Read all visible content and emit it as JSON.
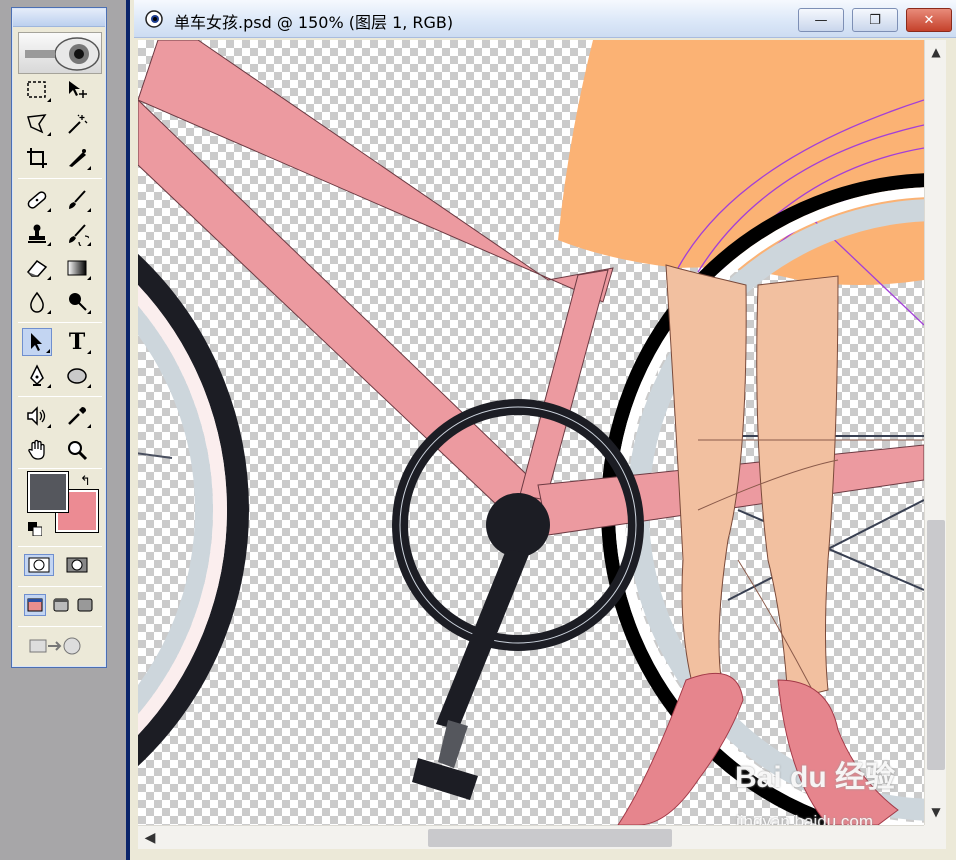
{
  "document": {
    "title": "单车女孩.psd @ 150% (图层 1, RGB)",
    "minimize_label": "—",
    "restore_label": "❐",
    "close_label": "✕"
  },
  "toolbox": {
    "tools": [
      {
        "name": "rectangular-marquee-icon",
        "active": false
      },
      {
        "name": "move-icon",
        "active": false
      },
      {
        "name": "polygonal-lasso-icon",
        "active": false
      },
      {
        "name": "magic-wand-icon",
        "active": false
      },
      {
        "name": "crop-icon",
        "active": false
      },
      {
        "name": "slice-icon",
        "active": false
      },
      {
        "name": "healing-brush-icon",
        "active": false
      },
      {
        "name": "brush-icon",
        "active": false
      },
      {
        "name": "clone-stamp-icon",
        "active": false
      },
      {
        "name": "history-brush-icon",
        "active": false
      },
      {
        "name": "eraser-icon",
        "active": false
      },
      {
        "name": "gradient-icon",
        "active": false
      },
      {
        "name": "blur-icon",
        "active": false
      },
      {
        "name": "dodge-icon",
        "active": false
      },
      {
        "name": "path-selection-icon",
        "active": true
      },
      {
        "name": "type-icon",
        "active": false,
        "glyph": "T"
      },
      {
        "name": "pen-icon",
        "active": false
      },
      {
        "name": "ellipse-icon",
        "active": false
      },
      {
        "name": "notes-icon",
        "active": false
      },
      {
        "name": "eyedropper-icon",
        "active": false
      },
      {
        "name": "hand-icon",
        "active": false
      },
      {
        "name": "zoom-icon",
        "active": false
      }
    ],
    "foreground_color": "#55575d",
    "background_color": "#ec8b93"
  },
  "colors": {
    "frame_pink": "#ec9aa0",
    "skirt_orange": "#fbb274",
    "skin": "#f2c0a0",
    "tire_dark": "#1c1d24",
    "rim_light": "#cdd6dc",
    "path_purple": "#a23fd8"
  },
  "watermark": {
    "brand": "Bai du 经验",
    "site": "jingyan.baidu.com"
  }
}
